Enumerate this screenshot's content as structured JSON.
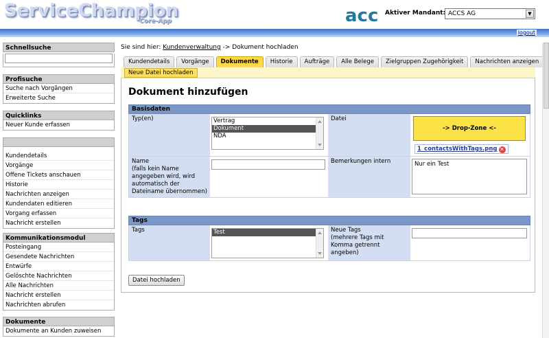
{
  "header": {
    "logo_main": "ServiceChampion",
    "logo_sub": "Core-App",
    "brand": "acc",
    "mandant_label": "Aktiver Mandant:",
    "mandant_value": "ACCS AG",
    "logout": "logout"
  },
  "sidebar": {
    "quicksearch_title": "Schnellsuche",
    "profisuche": {
      "title": "Profisuche",
      "items": [
        "Suche nach Vorgängen",
        "Erweiterte Suche"
      ]
    },
    "quicklinks": {
      "title": "Quicklinks",
      "items": [
        "Neuer Kunde erfassen"
      ]
    },
    "customer": {
      "items": [
        "Kundendetails",
        "Vorgänge",
        "Offene Tickets anschauen",
        "Historie",
        "Nachrichten anzeigen",
        "Kundendaten editieren",
        "Vorgang erfassen",
        "Nachricht erstellen"
      ]
    },
    "kommunikation": {
      "title": "Kommunikationsmodul",
      "items": [
        "Posteingang",
        "Gesendete Nachrichten",
        "Entwürfe",
        "Gelöschte Nachrichten",
        "Alle Nachrichten",
        "Nachricht erstellen",
        "Nachrichten abrufen"
      ]
    },
    "dokumente": {
      "title": "Dokumente",
      "items": [
        "Dokumente an Kunden zuweisen"
      ]
    }
  },
  "main": {
    "breadcrumb_prefix": "Sie sind hier:",
    "breadcrumb_link": "Kundenverwaltung",
    "breadcrumb_current": "-> Dokument hochladen",
    "tabs": [
      "Kundendetails",
      "Vorgänge",
      "Dokumente",
      "Historie",
      "Aufträge",
      "Alle Belege",
      "Zielgruppen Zugehörigkeit",
      "Nachrichten anzeigen"
    ],
    "active_tab": "Dokumente",
    "subtab": "Neue Datei hochladen",
    "page_title": "Dokument hinzufügen",
    "basisdaten": {
      "title": "Basisdaten",
      "typ_label": "Typ(en)",
      "typ_options": [
        "Vertrag",
        "Dokument",
        "NDA"
      ],
      "typ_selected": "Dokument",
      "datei_label": "Datei",
      "dropzone": "-> Drop-Zone <-",
      "file_name": "1_contactsWithTags.png",
      "name_label": "Name",
      "name_hint": "(falls kein Name angegeben wird, wird automatisch der Dateiname übernommen)",
      "name_value": "",
      "bemerkungen_label": "Bemerkungen intern",
      "bemerkungen_value": "Nur ein Test"
    },
    "tags": {
      "title": "Tags",
      "tags_label": "Tags",
      "tags_options": [
        "Test"
      ],
      "tags_selected": "Test",
      "neue_tags_label": "Neue Tags",
      "neue_tags_hint": "(mehrere Tags mit Komma getrennt angeben)",
      "neue_tags_value": ""
    },
    "upload_button": "Datei hochladen"
  },
  "colors": {
    "accent_yellow": "#ffd84a",
    "section_head": "#7a96c6",
    "label_bg": "#d4def2",
    "topbar": "#3b73c8"
  }
}
